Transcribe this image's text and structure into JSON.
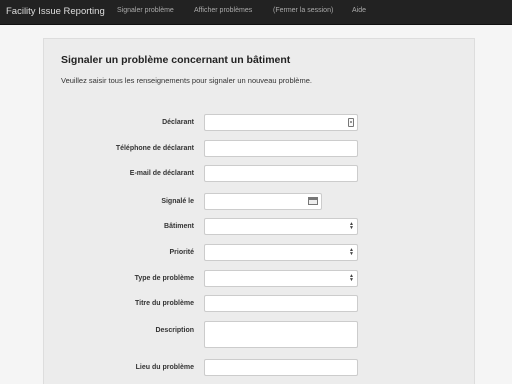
{
  "navbar": {
    "brand": "Facility Issue Reporting",
    "links": [
      "Signaler problème",
      "Afficher problèmes",
      "(Fermer la session)",
      "Aide"
    ]
  },
  "form": {
    "title": "Signaler un problème concernant un bâtiment",
    "subtitle": "Veuillez saisir tous les renseignements pour signaler un nouveau problème.",
    "fields": {
      "reporter": {
        "label": "Déclarant",
        "value": ""
      },
      "phone": {
        "label": "Téléphone de déclarant",
        "value": ""
      },
      "email": {
        "label": "E-mail de déclarant",
        "value": ""
      },
      "reported_on": {
        "label": "Signalé le",
        "value": ""
      },
      "building": {
        "label": "Bâtiment",
        "value": ""
      },
      "priority": {
        "label": "Priorité",
        "value": ""
      },
      "problem_type": {
        "label": "Type de problème",
        "value": ""
      },
      "problem_title": {
        "label": "Titre du problème",
        "value": ""
      },
      "description": {
        "label": "Description",
        "value": ""
      },
      "location": {
        "label": "Lieu du problème",
        "value": ""
      }
    }
  },
  "icons": {
    "reporter": "contact-card-icon",
    "reported_on": "calendar-icon",
    "selects": "select-arrows-icon"
  }
}
